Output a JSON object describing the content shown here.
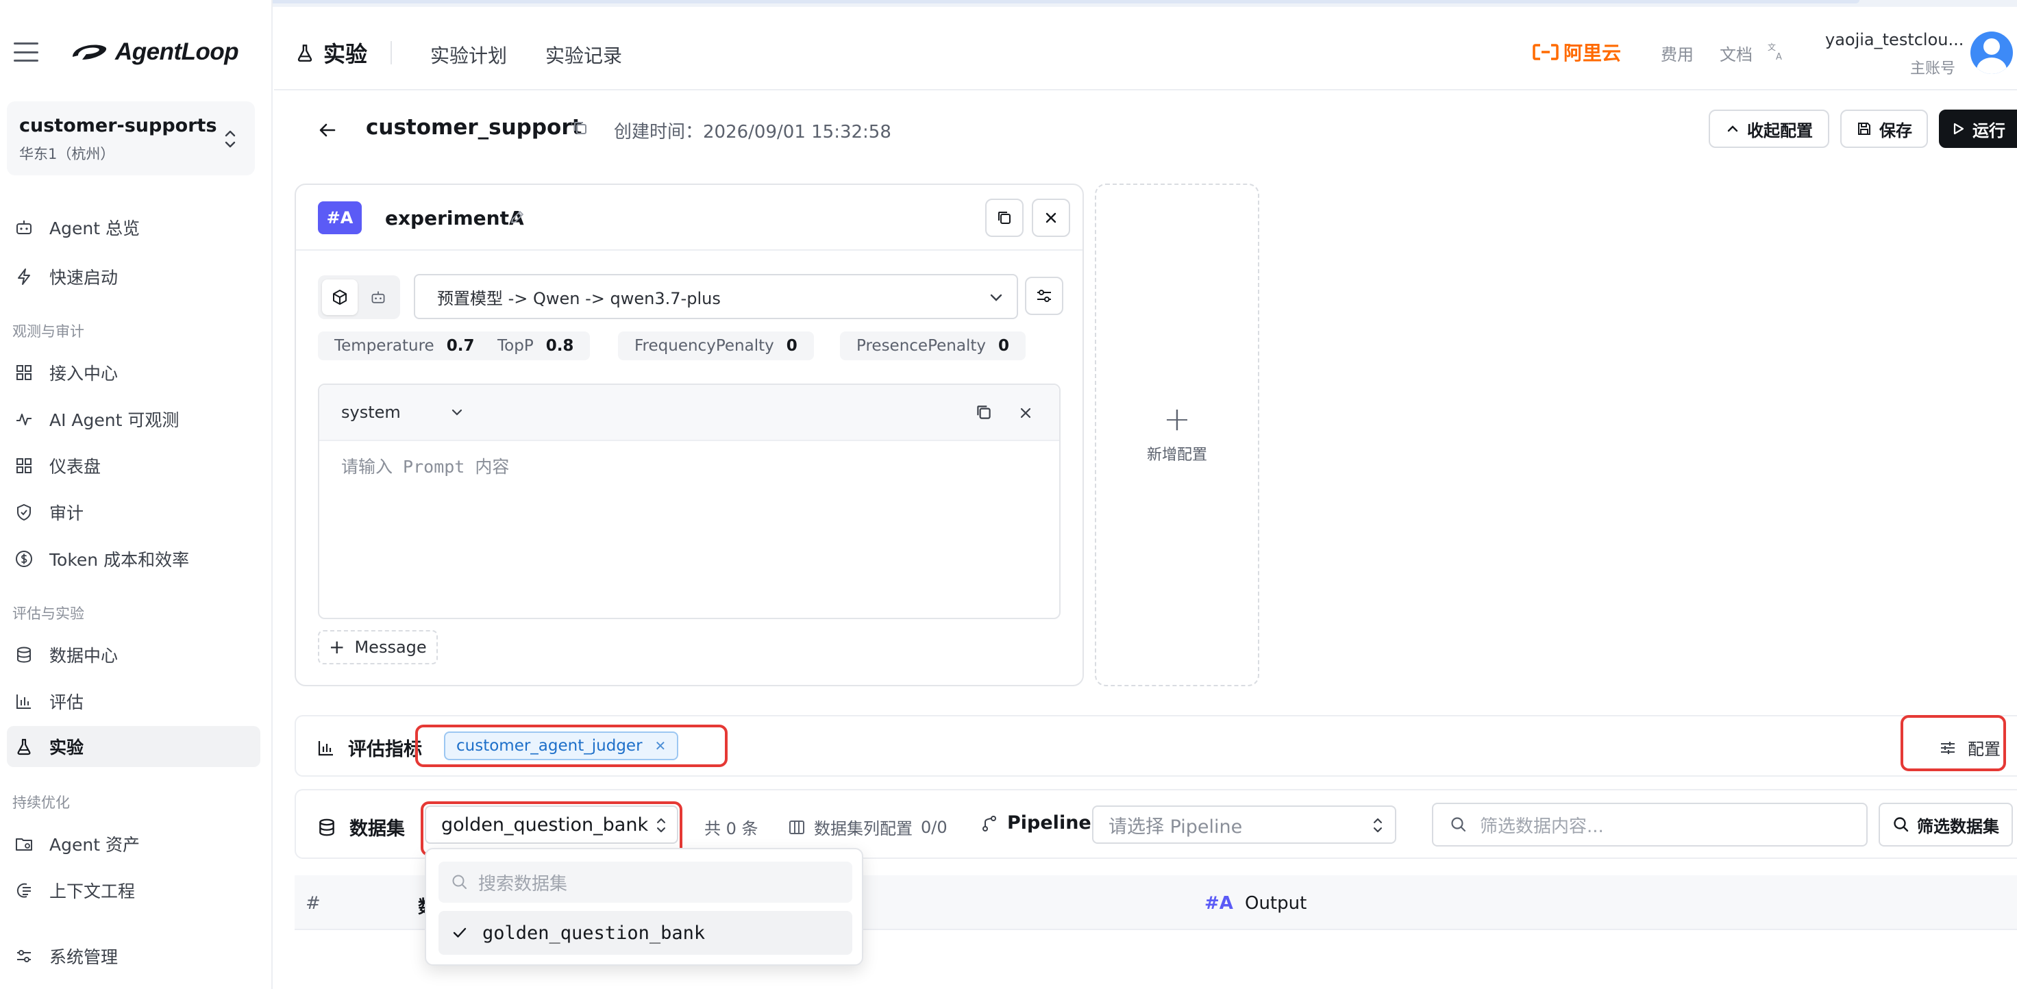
{
  "app": {
    "name": "AgentLoop"
  },
  "workspace": {
    "name": "customer-supports",
    "region": "华东1（杭州）"
  },
  "sidebar": {
    "groups": [
      "观测与审计",
      "评估与实验",
      "持续优化"
    ],
    "items": [
      {
        "label": "Agent 总览",
        "icon": "robot-icon"
      },
      {
        "label": "快速启动",
        "icon": "bolt-icon"
      },
      {
        "label": "接入中心",
        "icon": "grid-icon"
      },
      {
        "label": "AI Agent 可观测",
        "icon": "pulse-icon"
      },
      {
        "label": "仪表盘",
        "icon": "dashboard-icon"
      },
      {
        "label": "审计",
        "icon": "shield-icon"
      },
      {
        "label": "Token 成本和效率",
        "icon": "dollar-icon"
      },
      {
        "label": "数据中心",
        "icon": "database-icon"
      },
      {
        "label": "评估",
        "icon": "bar-chart-icon"
      },
      {
        "label": "实验",
        "icon": "flask-icon",
        "active": true
      },
      {
        "label": "Agent 资产",
        "icon": "folder-icon"
      },
      {
        "label": "上下文工程",
        "icon": "context-icon"
      },
      {
        "label": "系统管理",
        "icon": "settings-sliders-icon"
      }
    ]
  },
  "header": {
    "title": "实验",
    "tabs": [
      "实验计划",
      "实验记录"
    ],
    "brand": "阿里云",
    "links": [
      "费用",
      "文档"
    ],
    "user_name": "yaojia_testclou...",
    "user_role": "主账号"
  },
  "experiment": {
    "name": "customer_support",
    "created": "创建时间：2026/09/01 15:32:58",
    "buttons": {
      "collapse": "收起配置",
      "save": "保存",
      "run": "运行"
    }
  },
  "card": {
    "badge": "#A",
    "title": "experimentA",
    "model": "预置模型 -> Qwen -> qwen3.7-plus",
    "params": [
      {
        "name": "Temperature",
        "value": "0.7"
      },
      {
        "name": "TopP",
        "value": "0.8"
      },
      {
        "name": "FrequencyPenalty",
        "value": "0"
      },
      {
        "name": "PresencePenalty",
        "value": "0"
      }
    ],
    "role": "system",
    "prompt_placeholder": "请输入 Prompt 内容",
    "message_button": "Message"
  },
  "add_config": {
    "label": "新增配置"
  },
  "metrics": {
    "label": "评估指标",
    "tag": "customer_agent_judger",
    "config": "配置"
  },
  "dataset": {
    "label": "数据集",
    "selected": "golden_question_bank",
    "count": "共 0 条",
    "column_config": "数据集列配置",
    "column_count": "0/0",
    "pipeline_label": "Pipeline",
    "pipeline_placeholder": "请选择 Pipeline",
    "search_placeholder": "筛选数据内容...",
    "filter_button": "筛选数据集"
  },
  "table": {
    "col_index": "#",
    "col_data": "数",
    "col_output_prefix": "#A",
    "col_output": "Output"
  },
  "dropdown": {
    "search_placeholder": "搜索数据集",
    "options": [
      "golden_question_bank"
    ]
  },
  "colors": {
    "accent": "#5b5bf6",
    "brand": "#ff6a00",
    "highlight": "#e53935",
    "tag": "#1d6fc9"
  }
}
